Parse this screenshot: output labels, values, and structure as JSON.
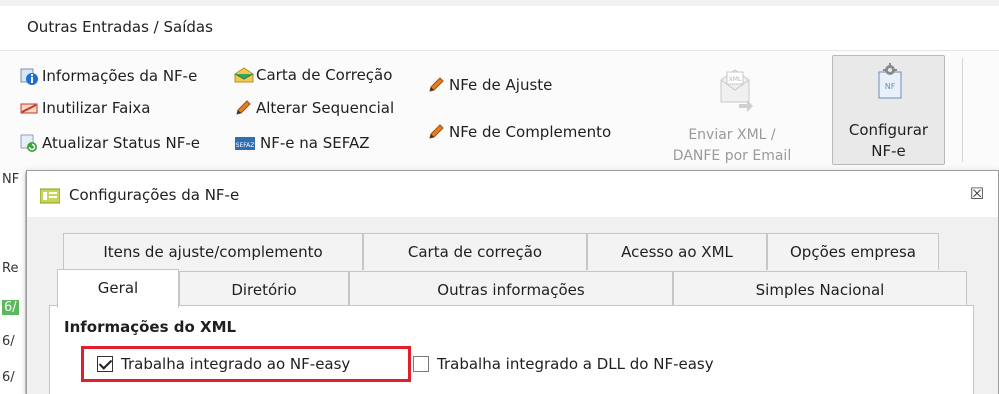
{
  "menu": {
    "title": "Outras Entradas / Saídas"
  },
  "ribbon": {
    "col1": [
      {
        "label": "Informações da NF-e",
        "icon": "info-icon"
      },
      {
        "label": "Inutilizar Faixa",
        "icon": "disable-icon"
      },
      {
        "label": "Atualizar Status NF-e",
        "icon": "refresh-status-icon"
      }
    ],
    "col2": [
      {
        "label": "Carta de Correção",
        "icon": "envelope-icon"
      },
      {
        "label": "Alterar Sequencial",
        "icon": "pencil-icon"
      },
      {
        "label": "NF-e na SEFAZ",
        "icon": "sefaz-icon"
      }
    ],
    "col3": [
      {
        "label": "NFe de Ajuste",
        "icon": "pencil-icon"
      },
      {
        "label": "NFe de Complemento",
        "icon": "pencil-icon"
      }
    ],
    "email": {
      "line1": "Enviar XML /",
      "line2": "DANFE por Email",
      "disabled": true
    },
    "configure": {
      "line1": "Configurar",
      "line2": "NF-e"
    }
  },
  "background": {
    "frag1": "NF",
    "frag2": "Re",
    "frag3": "6/",
    "frag4": "6/",
    "frag5": "6/"
  },
  "dialog": {
    "title": "Configurações da NF-e",
    "close_glyph": "☒",
    "tabs_row1": [
      {
        "label": "Itens de ajuste/complemento"
      },
      {
        "label": "Carta de correção"
      },
      {
        "label": "Acesso ao XML"
      },
      {
        "label": "Opções empresa"
      }
    ],
    "tabs_row2": [
      {
        "label": "Geral",
        "active": true
      },
      {
        "label": "Diretório"
      },
      {
        "label": "Outras informações"
      },
      {
        "label": "Simples Nacional"
      }
    ],
    "section_title": "Informações do XML",
    "checkboxes": [
      {
        "label": "Trabalha integrado ao NF-easy",
        "checked": true
      },
      {
        "label": "Trabalha integrado a DLL do NF-easy",
        "checked": false
      }
    ]
  },
  "colors": {
    "highlight": "#e0202a",
    "ribbon_bg": "#fbfbfb",
    "dialog_body": "#f0f0f0"
  }
}
